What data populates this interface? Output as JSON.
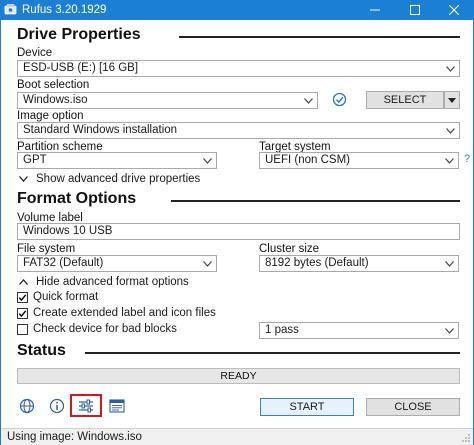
{
  "window": {
    "title": "Rufus 3.20.1929",
    "controls": [
      "minimize-icon",
      "maximize-icon",
      "close-icon"
    ]
  },
  "drive_properties": {
    "title": "Drive Properties",
    "device_label": "Device",
    "device_value": "ESD-USB (E:) [16 GB]",
    "boot_selection_label": "Boot selection",
    "boot_selection_value": "Windows.iso",
    "select_button": "SELECT",
    "image_option_label": "Image option",
    "image_option_value": "Standard Windows installation",
    "partition_scheme_label": "Partition scheme",
    "partition_scheme_value": "GPT",
    "target_system_label": "Target system",
    "target_system_value": "UEFI (non CSM)",
    "help_glyph": "?",
    "advanced_toggle": "Show advanced drive properties"
  },
  "format_options": {
    "title": "Format Options",
    "volume_label_label": "Volume label",
    "volume_label_value": "Windows 10 USB",
    "file_system_label": "File system",
    "file_system_value": "FAT32 (Default)",
    "cluster_size_label": "Cluster size",
    "cluster_size_value": "8192 bytes (Default)",
    "advanced_toggle": "Hide advanced format options",
    "quick_format_label": "Quick format",
    "quick_format_checked": true,
    "extended_label_label": "Create extended label and icon files",
    "extended_label_checked": true,
    "bad_blocks_label": "Check device for bad blocks",
    "bad_blocks_checked": false,
    "passes_value": "1 pass"
  },
  "status": {
    "title": "Status",
    "progress_text": "READY",
    "start_button": "START",
    "close_button": "CLOSE",
    "toolbar_icons": [
      "globe-icon",
      "info-icon",
      "settings-sliders-icon",
      "log-icon"
    ]
  },
  "status_bar": {
    "text": "Using image: Windows.iso"
  },
  "colors": {
    "titlebar": "#1c7fd6",
    "highlight": "#d8141c",
    "check_icon": "#1f75c9"
  }
}
